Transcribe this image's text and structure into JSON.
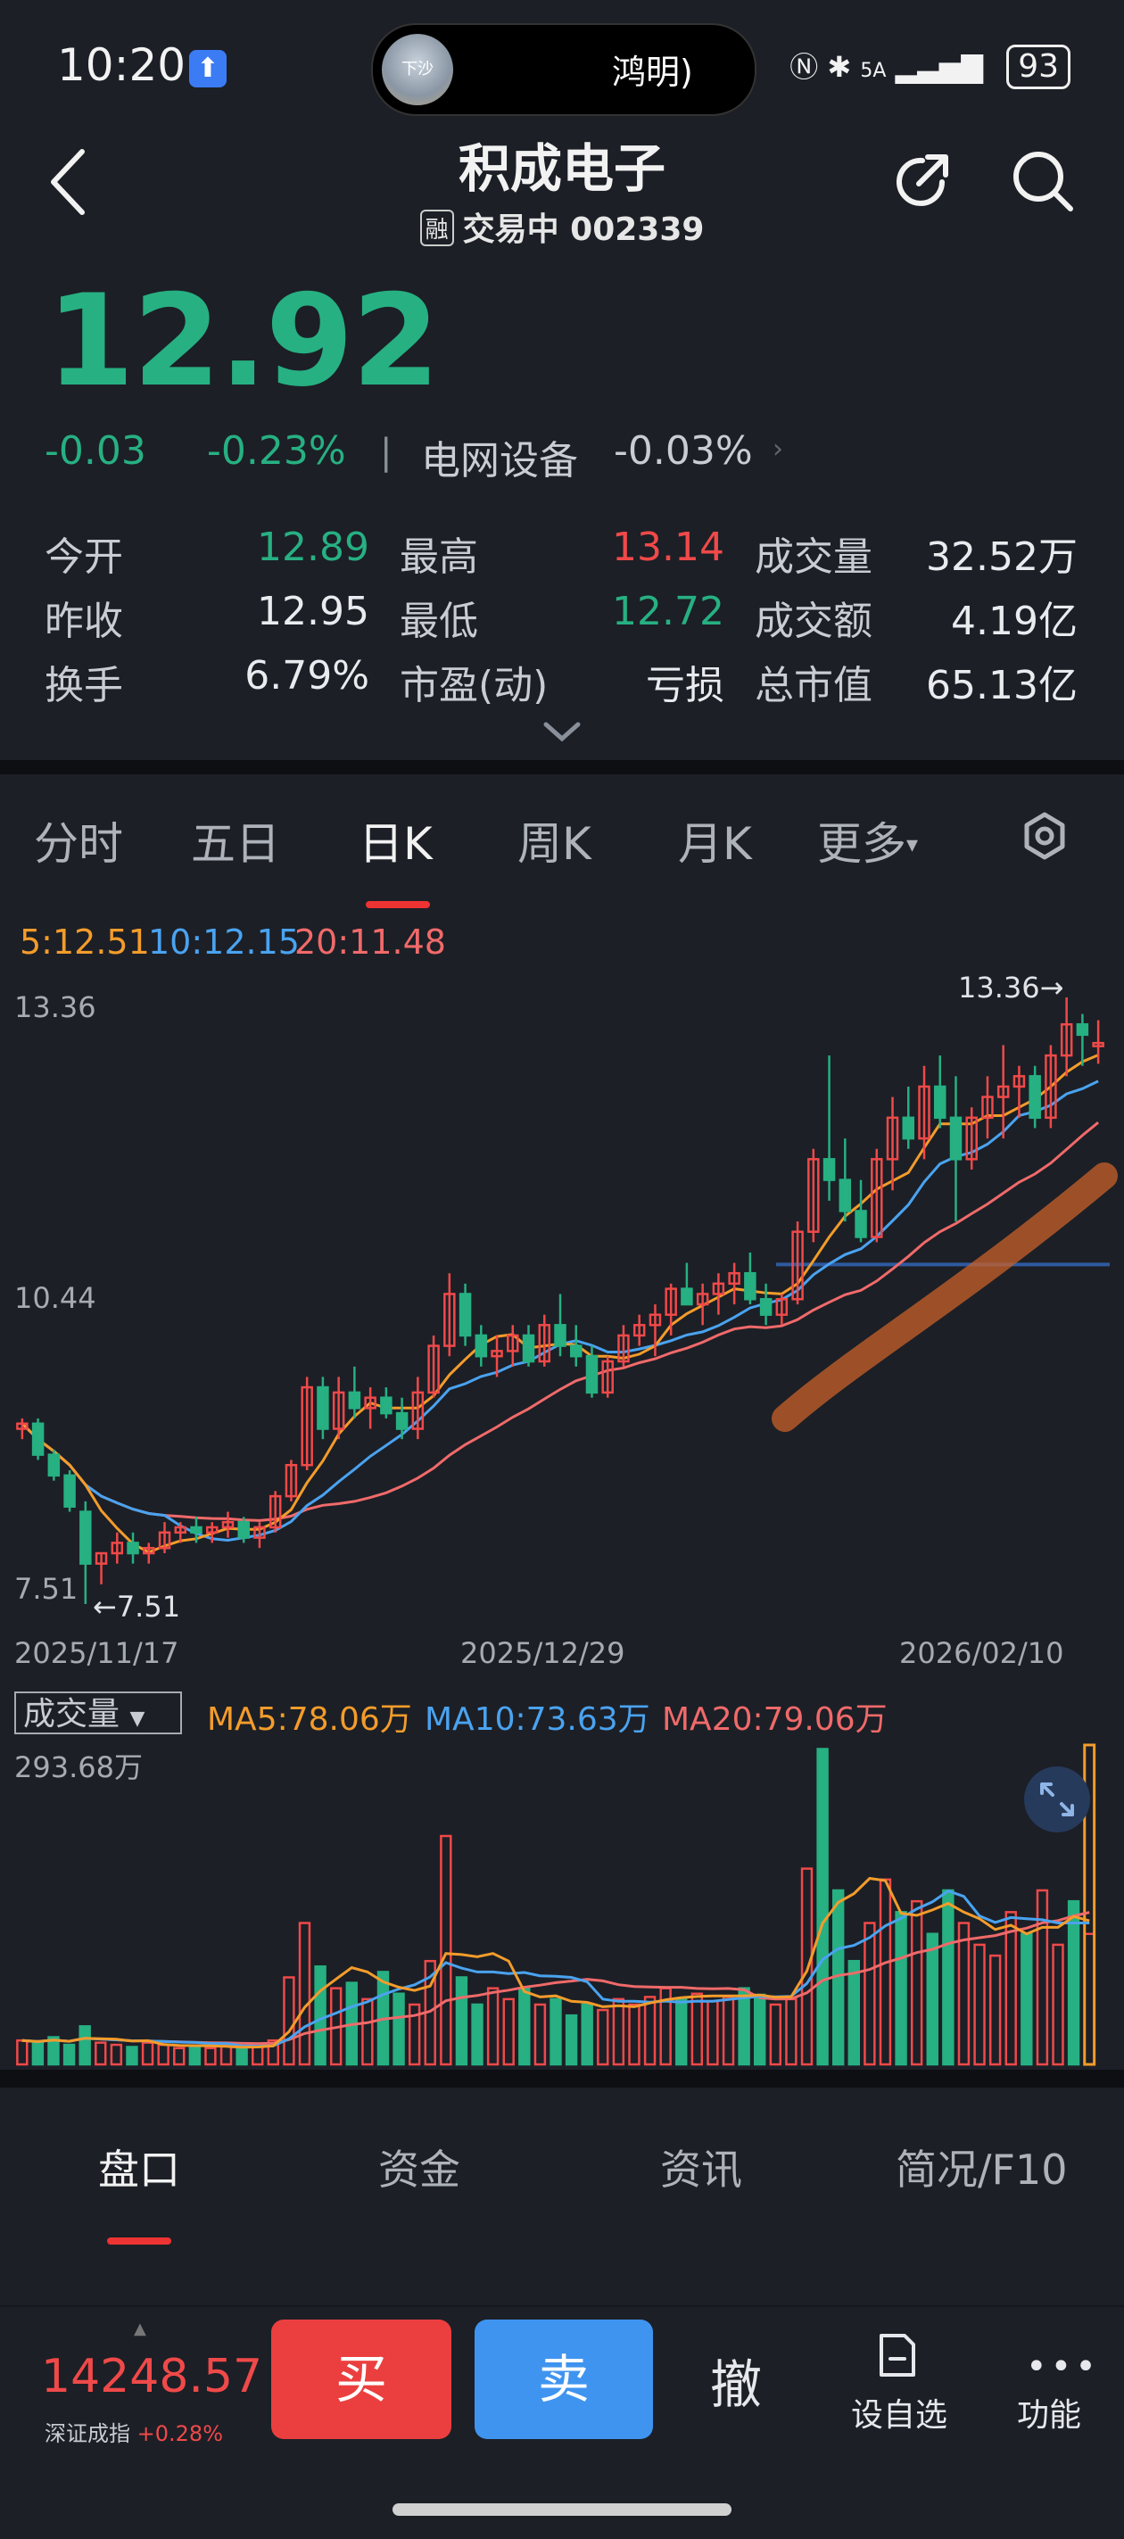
{
  "status": {
    "time": "10:20",
    "island_text": "鸿明)",
    "island_avatar_text": "下沙",
    "signal": "5A",
    "battery": "93"
  },
  "header": {
    "title": "积成电子",
    "badge": "融",
    "trade_status": "交易中",
    "code": "002339"
  },
  "quote": {
    "price": "12.92",
    "change": "-0.03",
    "change_pct": "-0.23%",
    "divider": "|",
    "sector": "电网设备",
    "sector_pct": "-0.03%",
    "sector_arrow": "›",
    "rows": [
      [
        {
          "label": "今开",
          "value": "12.89",
          "color": "green"
        },
        {
          "label": "最高",
          "value": "13.14",
          "color": "red"
        },
        {
          "label": "成交量",
          "value": "32.52万",
          "color": "white"
        }
      ],
      [
        {
          "label": "昨收",
          "value": "12.95",
          "color": "white"
        },
        {
          "label": "最低",
          "value": "12.72",
          "color": "green"
        },
        {
          "label": "成交额",
          "value": "4.19亿",
          "color": "white"
        }
      ],
      [
        {
          "label": "换手",
          "value": "6.79%",
          "color": "white"
        },
        {
          "label": "市盈(动)",
          "value": "亏损",
          "color": "white"
        },
        {
          "label": "总市值",
          "value": "65.13亿",
          "color": "white"
        }
      ]
    ]
  },
  "chart_tabs": {
    "items": [
      "分时",
      "五日",
      "日K",
      "周K",
      "月K",
      "更多"
    ],
    "active": "日K",
    "more_arrow": "▾"
  },
  "chart_data": {
    "type": "candlestick",
    "ma_legend": [
      {
        "label": "5:12.51",
        "color": "#f39c2b"
      },
      {
        "label": "10:12.15",
        "color": "#4aa3f0"
      },
      {
        "label": "20:11.48",
        "color": "#f06a6a"
      }
    ],
    "y_ticks": [
      "13.36",
      "10.44",
      "7.51"
    ],
    "ylim": [
      7.51,
      13.36
    ],
    "max_label": "13.36→",
    "min_label": "←7.51",
    "x_ticks": [
      "2025/11/17",
      "2025/12/29",
      "2026/02/10"
    ],
    "candles": [
      [
        9.2,
        9.3,
        9.1,
        9.25
      ],
      [
        9.25,
        9.3,
        8.9,
        8.95
      ],
      [
        8.95,
        9.0,
        8.7,
        8.75
      ],
      [
        8.75,
        8.8,
        8.4,
        8.45
      ],
      [
        8.4,
        8.5,
        7.51,
        7.9
      ],
      [
        7.9,
        8.0,
        7.7,
        8.0
      ],
      [
        8.0,
        8.2,
        7.9,
        8.1
      ],
      [
        8.1,
        8.2,
        7.9,
        8.0
      ],
      [
        8.0,
        8.1,
        7.9,
        8.05
      ],
      [
        8.05,
        8.3,
        8.0,
        8.2
      ],
      [
        8.2,
        8.3,
        8.1,
        8.25
      ],
      [
        8.25,
        8.35,
        8.1,
        8.2
      ],
      [
        8.2,
        8.3,
        8.1,
        8.25
      ],
      [
        8.25,
        8.4,
        8.15,
        8.3
      ],
      [
        8.3,
        8.35,
        8.1,
        8.15
      ],
      [
        8.15,
        8.3,
        8.05,
        8.25
      ],
      [
        8.25,
        8.6,
        8.2,
        8.55
      ],
      [
        8.55,
        8.9,
        8.5,
        8.85
      ],
      [
        8.85,
        9.7,
        8.8,
        9.6
      ],
      [
        9.6,
        9.7,
        9.1,
        9.2
      ],
      [
        9.2,
        9.7,
        9.1,
        9.55
      ],
      [
        9.55,
        9.8,
        9.3,
        9.4
      ],
      [
        9.4,
        9.6,
        9.2,
        9.5
      ],
      [
        9.5,
        9.6,
        9.3,
        9.35
      ],
      [
        9.35,
        9.5,
        9.1,
        9.2
      ],
      [
        9.2,
        9.7,
        9.1,
        9.55
      ],
      [
        9.55,
        10.1,
        9.5,
        10.0
      ],
      [
        10.0,
        10.7,
        9.9,
        10.5
      ],
      [
        10.5,
        10.6,
        10.0,
        10.1
      ],
      [
        10.1,
        10.2,
        9.8,
        9.9
      ],
      [
        9.9,
        10.1,
        9.7,
        9.95
      ],
      [
        9.95,
        10.2,
        9.8,
        10.1
      ],
      [
        10.1,
        10.2,
        9.8,
        9.85
      ],
      [
        9.85,
        10.3,
        9.8,
        10.2
      ],
      [
        10.2,
        10.5,
        9.9,
        10.0
      ],
      [
        10.0,
        10.2,
        9.8,
        9.9
      ],
      [
        9.9,
        10.0,
        9.5,
        9.55
      ],
      [
        9.55,
        9.9,
        9.5,
        9.85
      ],
      [
        9.85,
        10.2,
        9.8,
        10.1
      ],
      [
        10.1,
        10.3,
        10.0,
        10.2
      ],
      [
        10.2,
        10.4,
        9.9,
        10.3
      ],
      [
        10.3,
        10.6,
        10.1,
        10.55
      ],
      [
        10.55,
        10.8,
        10.4,
        10.4
      ],
      [
        10.4,
        10.6,
        10.2,
        10.5
      ],
      [
        10.5,
        10.7,
        10.3,
        10.6
      ],
      [
        10.6,
        10.8,
        10.4,
        10.7
      ],
      [
        10.7,
        10.9,
        10.4,
        10.45
      ],
      [
        10.45,
        10.6,
        10.2,
        10.3
      ],
      [
        10.3,
        10.5,
        10.2,
        10.45
      ],
      [
        10.45,
        11.2,
        10.4,
        11.1
      ],
      [
        11.1,
        11.9,
        11.0,
        11.8
      ],
      [
        11.8,
        12.8,
        11.4,
        11.6
      ],
      [
        11.6,
        12.0,
        11.2,
        11.3
      ],
      [
        11.3,
        11.6,
        11.0,
        11.05
      ],
      [
        11.05,
        11.9,
        11.0,
        11.8
      ],
      [
        11.8,
        12.4,
        11.5,
        12.2
      ],
      [
        12.2,
        12.5,
        11.9,
        12.0
      ],
      [
        12.0,
        12.7,
        11.8,
        12.5
      ],
      [
        12.5,
        12.8,
        12.1,
        12.2
      ],
      [
        12.2,
        12.6,
        11.2,
        11.8
      ],
      [
        11.8,
        12.3,
        11.7,
        12.2
      ],
      [
        12.2,
        12.6,
        12.0,
        12.4
      ],
      [
        12.4,
        12.9,
        12.0,
        12.5
      ],
      [
        12.5,
        12.7,
        12.2,
        12.6
      ],
      [
        12.6,
        12.7,
        12.1,
        12.2
      ],
      [
        12.2,
        12.9,
        12.1,
        12.8
      ],
      [
        12.8,
        13.36,
        12.6,
        13.1
      ],
      [
        13.1,
        13.2,
        12.7,
        13.0
      ],
      [
        12.89,
        13.14,
        12.72,
        12.92
      ]
    ],
    "volume": {
      "selector": "成交量",
      "selector_arrow": "▼",
      "ma_legend": [
        {
          "label": "MA5:78.06万",
          "color": "#f39c2b"
        },
        {
          "label": "MA10:73.63万",
          "color": "#4aa3f0"
        },
        {
          "label": "MA20:79.06万",
          "color": "#f06a6a"
        }
      ],
      "max_label": "293.68万",
      "ymax": 293.68,
      "values": [
        22,
        20,
        25,
        18,
        35,
        20,
        18,
        16,
        20,
        18,
        15,
        17,
        15,
        18,
        14,
        16,
        22,
        80,
        130,
        90,
        70,
        75,
        60,
        85,
        65,
        55,
        95,
        210,
        80,
        55,
        70,
        60,
        70,
        55,
        60,
        45,
        55,
        50,
        60,
        55,
        62,
        70,
        60,
        65,
        58,
        62,
        70,
        64,
        55,
        60,
        180,
        290,
        160,
        95,
        130,
        170,
        140,
        150,
        120,
        160,
        130,
        110,
        100,
        140,
        120,
        160,
        110,
        150,
        120
      ]
    }
  },
  "bottom_tabs": {
    "items": [
      "盘口",
      "资金",
      "资讯",
      "简况/F10"
    ],
    "active": "盘口"
  },
  "trade_bar": {
    "index_value": "14248.57",
    "index_name": "深证成指",
    "index_pct": "+0.28%",
    "buy": "买",
    "sell": "卖",
    "cancel": "撤",
    "add_fav": "设自选",
    "func": "功能",
    "func_dots": "•••"
  },
  "colors": {
    "up": "#f04949",
    "down": "#27b082",
    "background": "#1c1f26",
    "buy": "#eb3f3f",
    "sell": "#3f94f0"
  }
}
